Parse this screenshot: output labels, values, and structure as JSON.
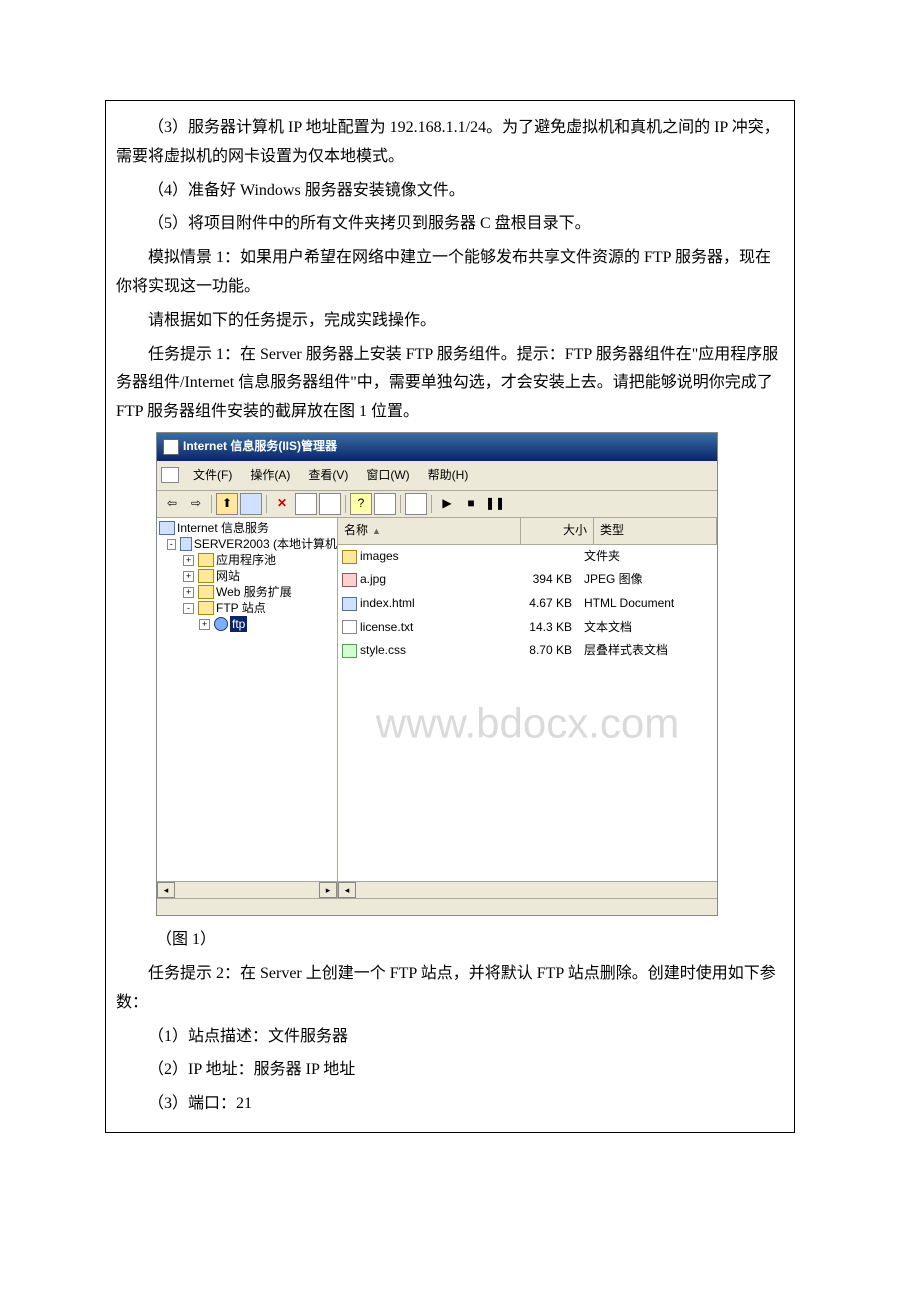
{
  "doc": {
    "p1": "（3）服务器计算机 IP 地址配置为 192.168.1.1/24。为了避免虚拟机和真机之间的 IP 冲突，需要将虚拟机的网卡设置为仅本地模式。",
    "p2": "（4）准备好 Windows 服务器安装镜像文件。",
    "p3": "（5）将项目附件中的所有文件夹拷贝到服务器 C 盘根目录下。",
    "p4": "模拟情景 1：如果用户希望在网络中建立一个能够发布共享文件资源的 FTP 服务器，现在你将实现这一功能。",
    "p5": "请根据如下的任务提示，完成实践操作。",
    "p6": "任务提示 1：在 Server 服务器上安装 FTP 服务组件。提示：FTP 服务器组件在\"应用程序服务器组件/Internet 信息服务器组件\"中，需要单独勾选，才会安装上去。请把能够说明你完成了 FTP 服务器组件安装的截屏放在图 1 位置。",
    "fig1": "（图 1）",
    "p7": "任务提示 2：在 Server 上创建一个 FTP 站点，并将默认 FTP 站点删除。创建时使用如下参数：",
    "p8": "（1）站点描述：文件服务器",
    "p9": "（2）IP 地址：服务器 IP 地址",
    "p10": "（3）端口：21"
  },
  "iis": {
    "title": "Internet 信息服务(IIS)管理器",
    "menu": {
      "file": "文件(F)",
      "action": "操作(A)",
      "view": "查看(V)",
      "window": "窗口(W)",
      "help": "帮助(H)"
    },
    "tree": {
      "root": "Internet 信息服务",
      "server": "SERVER2003 (本地计算机",
      "apppool": "应用程序池",
      "website": "网站",
      "webext": "Web 服务扩展",
      "ftpsite": "FTP 站点",
      "ftp": "ftp"
    },
    "listHeader": {
      "name": "名称",
      "size": "大小",
      "type": "类型"
    },
    "files": [
      {
        "name": "images",
        "size": "",
        "type": "文件夹",
        "icon": "folder"
      },
      {
        "name": "a.jpg",
        "size": "394 KB",
        "type": "JPEG 图像",
        "icon": "jpg"
      },
      {
        "name": "index.html",
        "size": "4.67 KB",
        "type": "HTML Document",
        "icon": "html"
      },
      {
        "name": "license.txt",
        "size": "14.3 KB",
        "type": "文本文档",
        "icon": "txt"
      },
      {
        "name": "style.css",
        "size": "8.70 KB",
        "type": "层叠样式表文档",
        "icon": "css"
      }
    ],
    "watermark": "www.bdocx.com"
  }
}
